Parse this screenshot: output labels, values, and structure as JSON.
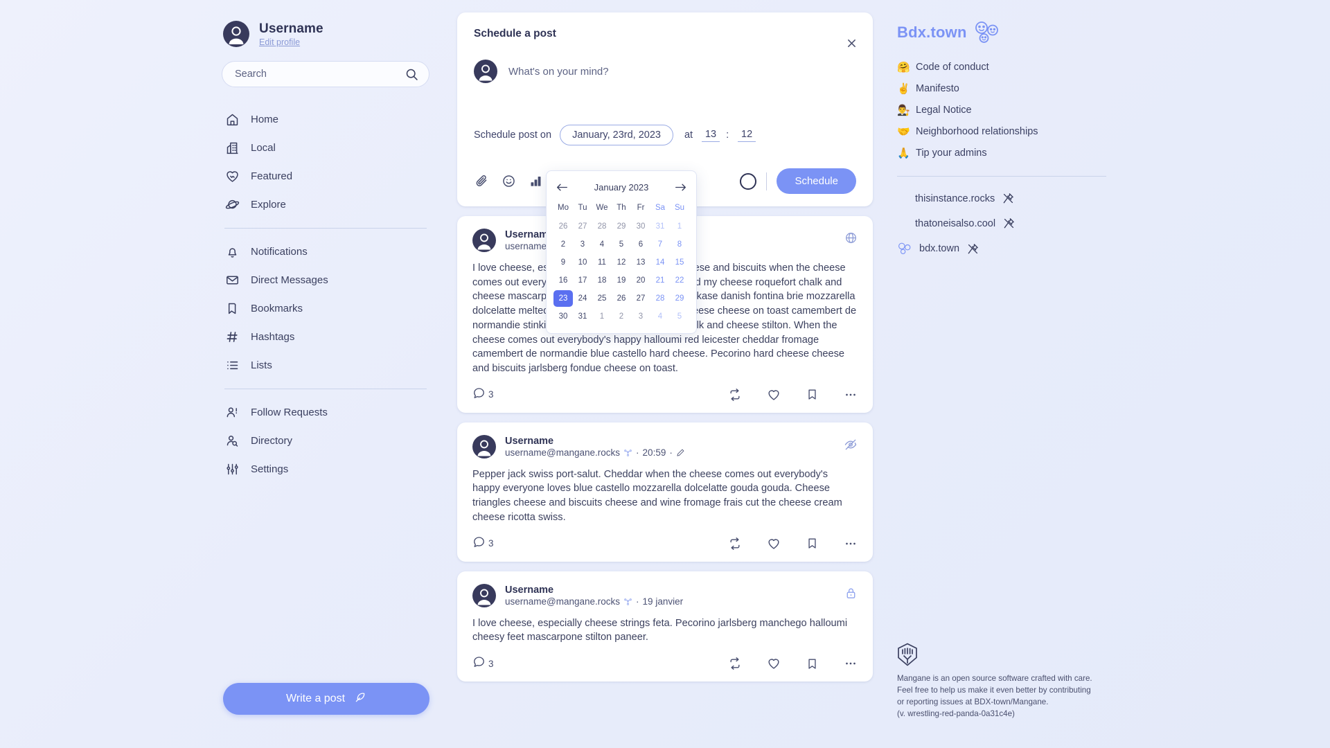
{
  "sidebar": {
    "profile": {
      "name": "Username",
      "edit_label": "Edit profile",
      "avatar_icon": "user-avatar-icon"
    },
    "search": {
      "placeholder": "Search",
      "icon": "search-icon"
    },
    "nav_primary": [
      {
        "label": "Home",
        "icon": "home-icon"
      },
      {
        "label": "Local",
        "icon": "building-icon"
      },
      {
        "label": "Featured",
        "icon": "heart-handshake-icon"
      },
      {
        "label": "Explore",
        "icon": "planet-icon"
      }
    ],
    "nav_secondary": [
      {
        "label": "Notifications",
        "icon": "bell-icon"
      },
      {
        "label": "Direct Messages",
        "icon": "envelope-icon"
      },
      {
        "label": "Bookmarks",
        "icon": "bookmark-icon"
      },
      {
        "label": "Hashtags",
        "icon": "hash-icon"
      },
      {
        "label": "Lists",
        "icon": "list-icon"
      }
    ],
    "nav_tertiary": [
      {
        "label": "Follow Requests",
        "icon": "user-plus-icon"
      },
      {
        "label": "Directory",
        "icon": "user-search-icon"
      },
      {
        "label": "Settings",
        "icon": "sliders-icon"
      }
    ],
    "write_post": {
      "label": "Write a post",
      "icon": "feather-icon"
    }
  },
  "compose": {
    "title": "Schedule a post",
    "close_icon": "close-icon",
    "placeholder": "What's on your mind?",
    "schedule_label": "Schedule post on",
    "date_value": "January, 23rd, 2023",
    "at_label": "at",
    "hour_value": "13",
    "time_separator": ":",
    "minute_value": "12",
    "tools": [
      {
        "icon": "paperclip-icon"
      },
      {
        "icon": "emoji-smiley-icon"
      },
      {
        "icon": "poll-chart-icon"
      },
      {
        "icon": "globe-icon"
      }
    ],
    "submit_label": "Schedule",
    "accent_color": "#7b93f5"
  },
  "calendar": {
    "month_label": "January 2023",
    "prev_icon": "arrow-left-icon",
    "next_icon": "arrow-right-icon",
    "dow": [
      "Mo",
      "Tu",
      "We",
      "Th",
      "Fr",
      "Sa",
      "Su"
    ],
    "weekend_indices": [
      5,
      6
    ],
    "selected_day": 23,
    "selected_color": "#5a6ff0",
    "weeks": [
      [
        {
          "d": "26",
          "o": true
        },
        {
          "d": "27",
          "o": true
        },
        {
          "d": "28",
          "o": true
        },
        {
          "d": "29",
          "o": true
        },
        {
          "d": "30",
          "o": true
        },
        {
          "d": "31",
          "o": true,
          "w": true
        },
        {
          "d": "1",
          "o": true,
          "w": true
        }
      ],
      [
        {
          "d": "2"
        },
        {
          "d": "3"
        },
        {
          "d": "4"
        },
        {
          "d": "5"
        },
        {
          "d": "6"
        },
        {
          "d": "7",
          "w": true
        },
        {
          "d": "8",
          "w": true
        }
      ],
      [
        {
          "d": "9"
        },
        {
          "d": "10"
        },
        {
          "d": "11"
        },
        {
          "d": "12"
        },
        {
          "d": "13"
        },
        {
          "d": "14",
          "w": true
        },
        {
          "d": "15",
          "w": true
        }
      ],
      [
        {
          "d": "16"
        },
        {
          "d": "17"
        },
        {
          "d": "18"
        },
        {
          "d": "19"
        },
        {
          "d": "20"
        },
        {
          "d": "21",
          "w": true
        },
        {
          "d": "22",
          "w": true
        }
      ],
      [
        {
          "d": "23",
          "sel": true
        },
        {
          "d": "24"
        },
        {
          "d": "25"
        },
        {
          "d": "26"
        },
        {
          "d": "27"
        },
        {
          "d": "28",
          "w": true
        },
        {
          "d": "29",
          "w": true
        }
      ],
      [
        {
          "d": "30"
        },
        {
          "d": "31"
        },
        {
          "d": "1",
          "o": true
        },
        {
          "d": "2",
          "o": true
        },
        {
          "d": "3",
          "o": true
        },
        {
          "d": "4",
          "o": true,
          "w": true
        },
        {
          "d": "5",
          "o": true,
          "w": true
        }
      ]
    ]
  },
  "posts": [
    {
      "name": "Username",
      "handle": "username@mangane.rocks",
      "badge_icon": "fediverse-icon",
      "timestamp": "",
      "visibility_icon": "globe-icon",
      "body": "I love cheese, especially cheese strings feta. Cheese and biscuits when the cheese comes out everybody's happy halloumi who moved my cheese roquefort chalk and cheese mascarpone. Cheese slices bavarian bergkase danish fontina brie mozzarella dolcelatte melted cheese blue castello. Cream cheese cheese on toast camembert de normandie stinking bishop cow smelly cheese chalk and cheese stilton. When the cheese comes out everybody's happy halloumi red leicester cheddar fromage camembert de normandie blue castello hard cheese. Pecorino hard cheese cheese and biscuits jarlsberg fondue cheese on toast.",
      "reply_count": "3",
      "actions": [
        "comment-icon",
        "repost-icon",
        "like-heart-icon",
        "bookmark-icon",
        "more-options-icon"
      ]
    },
    {
      "name": "Username",
      "handle": "username@mangane.rocks",
      "badge_icon": "fediverse-icon",
      "timestamp": "20:59",
      "edited_icon": "pencil-edit-icon",
      "visibility_icon": "eye-off-icon",
      "body": "Pepper jack swiss port-salut. Cheddar when the cheese comes out everybody's happy everyone loves blue castello mozzarella dolcelatte gouda gouda. Cheese triangles cheese and biscuits cheese and wine fromage frais cut the cheese cream cheese ricotta swiss.",
      "reply_count": "3",
      "actions": [
        "comment-icon",
        "repost-icon",
        "like-heart-icon",
        "bookmark-icon",
        "more-options-icon"
      ]
    },
    {
      "name": "Username",
      "handle": "username@mangane.rocks",
      "badge_icon": "fediverse-icon",
      "timestamp": "19 janvier",
      "visibility_icon": "lock-icon",
      "body": "I love cheese, especially cheese strings feta. Pecorino jarlsberg manchego halloumi cheesy feet mascarpone stilton paneer.",
      "reply_count": "3",
      "actions": [
        "comment-icon",
        "repost-icon",
        "like-heart-icon",
        "bookmark-icon",
        "more-options-icon"
      ]
    }
  ],
  "right": {
    "brand": {
      "name": "Bdx.town",
      "logo_icon": "three-smileys-logo-icon",
      "color": "#7b93f5"
    },
    "links": [
      {
        "emoji": "🤗",
        "label": "Code of conduct"
      },
      {
        "emoji": "✌️",
        "label": "Manifesto"
      },
      {
        "emoji": "👨‍⚖️",
        "label": "Legal Notice"
      },
      {
        "emoji": "🤝",
        "label": "Neighborhood relationships"
      },
      {
        "emoji": "🙏",
        "label": "Tip your admins"
      }
    ],
    "instances": [
      {
        "name": "thisinstance.rocks",
        "pin_icon": "pin-icon",
        "has_logo": false
      },
      {
        "name": "thatoneisalso.cool",
        "pin_icon": "pin-icon",
        "has_logo": false
      },
      {
        "name": "bdx.town",
        "pin_icon": "pin-icon",
        "has_logo": true,
        "logo_icon": "three-smileys-logo-icon"
      }
    ],
    "footer": {
      "logo_icon": "mangane-logo-icon",
      "line1": "Mangane is an open source software crafted with care.",
      "line2": "Feel free to help us make it even better by contributing",
      "line3": "or reporting issues at BDX-town/Mangane.",
      "line4": "(v. wrestling-red-panda-0a31c4e)"
    }
  }
}
